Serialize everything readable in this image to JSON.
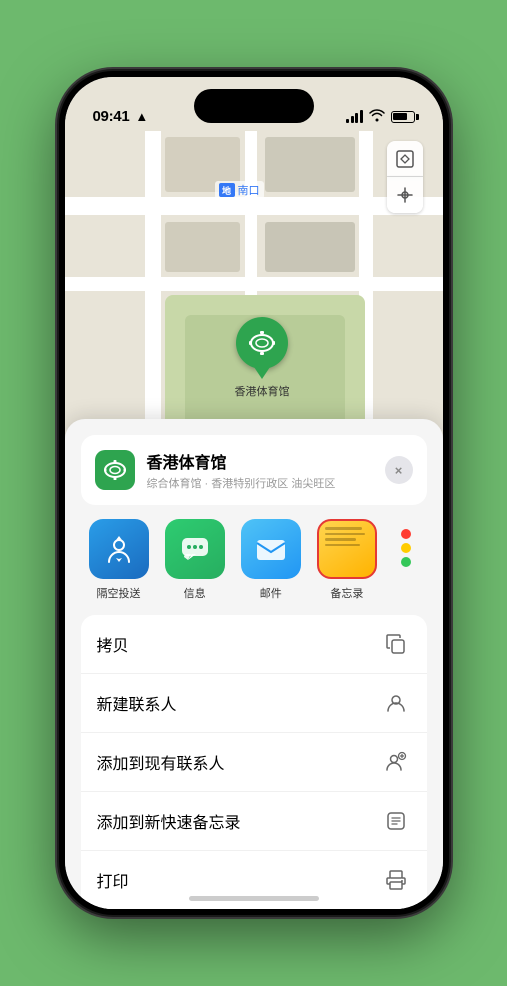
{
  "status_bar": {
    "time": "09:41",
    "location_arrow": "▶"
  },
  "map": {
    "label_nankou": "南口",
    "subway_text": "地",
    "stadium_label": "香港体育馆",
    "controls": {
      "map_type": "🗺",
      "location": "⬆"
    }
  },
  "location_card": {
    "name": "香港体育馆",
    "detail": "综合体育馆 · 香港特别行政区 油尖旺区",
    "close": "×"
  },
  "share_items": [
    {
      "id": "airdrop",
      "label": "隔空投送"
    },
    {
      "id": "message",
      "label": "信息"
    },
    {
      "id": "mail",
      "label": "邮件"
    },
    {
      "id": "notes",
      "label": "备忘录"
    }
  ],
  "actions": [
    {
      "id": "copy",
      "label": "拷贝",
      "icon": "copy"
    },
    {
      "id": "new-contact",
      "label": "新建联系人",
      "icon": "person"
    },
    {
      "id": "add-existing",
      "label": "添加到现有联系人",
      "icon": "person-add"
    },
    {
      "id": "add-notes",
      "label": "添加到新快速备忘录",
      "icon": "note"
    },
    {
      "id": "print",
      "label": "打印",
      "icon": "printer"
    }
  ]
}
